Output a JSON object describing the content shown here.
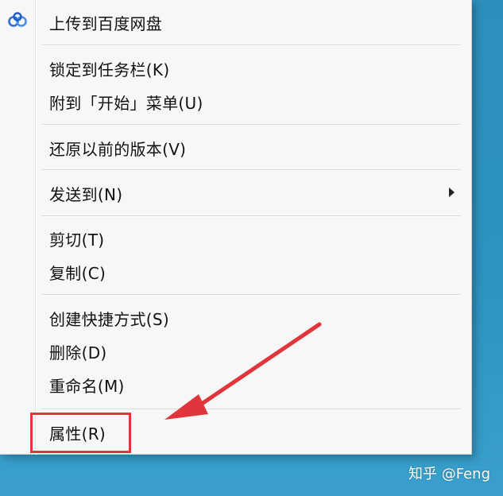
{
  "menu": {
    "items": [
      {
        "label": "上传到百度网盘"
      },
      {
        "label": "锁定到任务栏(K)"
      },
      {
        "label": "附到「开始」菜单(U)"
      },
      {
        "label": "还原以前的版本(V)"
      },
      {
        "label": "发送到(N)"
      },
      {
        "label": "剪切(T)"
      },
      {
        "label": "复制(C)"
      },
      {
        "label": "创建快捷方式(S)"
      },
      {
        "label": "删除(D)"
      },
      {
        "label": "重命名(M)"
      },
      {
        "label": "属性(R)"
      }
    ],
    "icons": {
      "baidu": "baidu-netdisk-icon",
      "submenu": "chevron-right-icon"
    }
  },
  "annotation": {
    "color": "#e0353b"
  },
  "watermark": {
    "text": "知乎 @Feng"
  },
  "colors": {
    "desktop": "#2c93c2",
    "menu_bg": "#f7f7f7"
  }
}
